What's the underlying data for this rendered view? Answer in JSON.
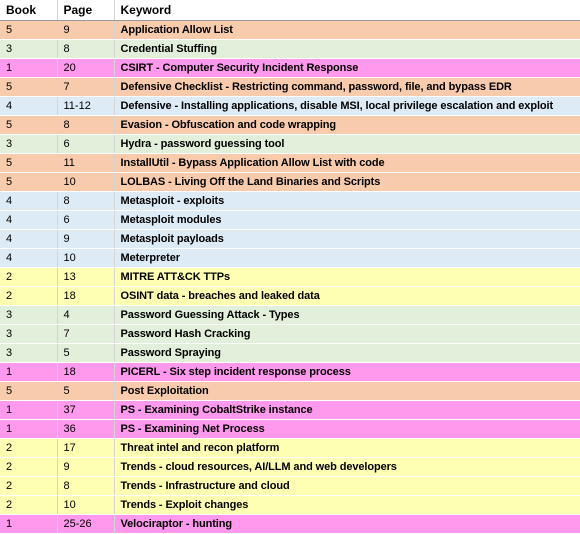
{
  "header": {
    "book": "Book",
    "page": "Page",
    "keyword": "Keyword"
  },
  "colors": {
    "orange": "#f8cbad",
    "green": "#e2efda",
    "pink": "#ff99ee",
    "blue": "#ddebf7",
    "yellow": "#ffffb4"
  },
  "rows": [
    {
      "book": "5",
      "page": "9",
      "keyword": "Application Allow List",
      "color": "orange"
    },
    {
      "book": "3",
      "page": "8",
      "keyword": "Credential Stuffing",
      "color": "green"
    },
    {
      "book": "1",
      "page": "20",
      "keyword": "CSIRT - Computer Security Incident Response",
      "color": "pink"
    },
    {
      "book": "5",
      "page": "7",
      "keyword": "Defensive Checklist - Restricting command, password, file, and bypass EDR",
      "color": "orange"
    },
    {
      "book": "4",
      "page": "11-12",
      "keyword": "Defensive - Installing applications, disable MSI, local privilege escalation and exploit",
      "color": "blue"
    },
    {
      "book": "5",
      "page": "8",
      "keyword": "Evasion - Obfuscation and code wrapping",
      "color": "orange"
    },
    {
      "book": "3",
      "page": "6",
      "keyword": "Hydra - password guessing tool",
      "color": "green"
    },
    {
      "book": "5",
      "page": "11",
      "keyword": "InstallUtil - Bypass Application Allow List with code",
      "color": "orange"
    },
    {
      "book": "5",
      "page": "10",
      "keyword": "LOLBAS - Living Off the Land Binaries and Scripts",
      "color": "orange"
    },
    {
      "book": "4",
      "page": "8",
      "keyword": "Metasploit - exploits",
      "color": "blue"
    },
    {
      "book": "4",
      "page": "6",
      "keyword": "Metasploit modules",
      "color": "blue"
    },
    {
      "book": "4",
      "page": "9",
      "keyword": "Metasploit payloads",
      "color": "blue"
    },
    {
      "book": "4",
      "page": "10",
      "keyword": "Meterpreter",
      "color": "blue"
    },
    {
      "book": "2",
      "page": "13",
      "keyword": "MITRE ATT&CK TTPs",
      "color": "yellow"
    },
    {
      "book": "2",
      "page": "18",
      "keyword": "OSINT data - breaches and leaked data",
      "color": "yellow"
    },
    {
      "book": "3",
      "page": "4",
      "keyword": "Password Guessing Attack - Types",
      "color": "green"
    },
    {
      "book": "3",
      "page": "7",
      "keyword": "Password Hash Cracking",
      "color": "green"
    },
    {
      "book": "3",
      "page": "5",
      "keyword": "Password Spraying",
      "color": "green"
    },
    {
      "book": "1",
      "page": "18",
      "keyword": "PICERL - Six step incident response process",
      "color": "pink"
    },
    {
      "book": "5",
      "page": "5",
      "keyword": "Post Exploitation",
      "color": "orange"
    },
    {
      "book": "1",
      "page": "37",
      "keyword": "PS - Examining CobaltStrike instance",
      "color": "pink"
    },
    {
      "book": "1",
      "page": "36",
      "keyword": "PS - Examining Net Process",
      "color": "pink"
    },
    {
      "book": "2",
      "page": "17",
      "keyword": "Threat intel and recon platform",
      "color": "yellow"
    },
    {
      "book": "2",
      "page": "9",
      "keyword": "Trends - cloud resources, AI/LLM and web developers",
      "color": "yellow"
    },
    {
      "book": "2",
      "page": "8",
      "keyword": "Trends - Infrastructure and cloud",
      "color": "yellow"
    },
    {
      "book": "2",
      "page": "10",
      "keyword": "Trends - Exploit changes",
      "color": "yellow"
    },
    {
      "book": "1",
      "page": "25-26",
      "keyword": "Velociraptor - hunting",
      "color": "pink"
    }
  ]
}
